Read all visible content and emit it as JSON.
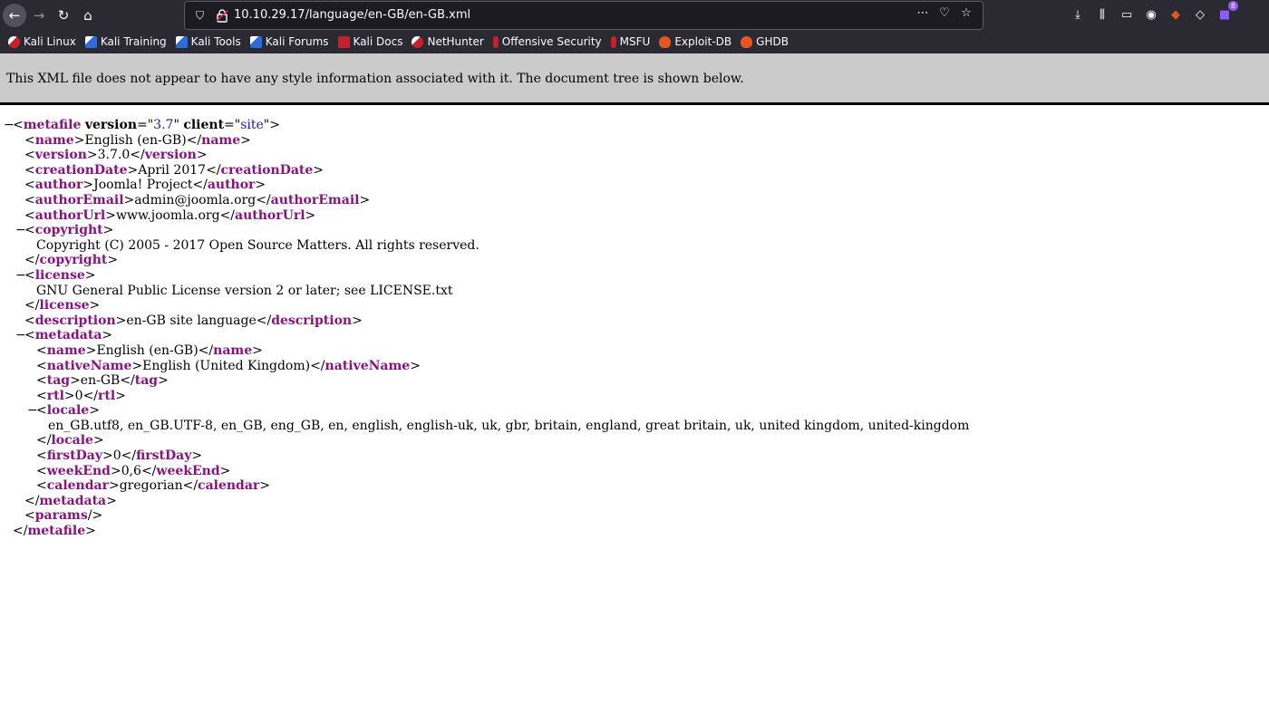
{
  "browser": {
    "url": "10.10.29.17/language/en-GB/en-GB.xml",
    "extension_count": "8",
    "bookmarks": [
      {
        "label": "Kali Linux",
        "icon": "kali-icon"
      },
      {
        "label": "Kali Training",
        "icon": "kali-training-icon"
      },
      {
        "label": "Kali Tools",
        "icon": "kali-tools-icon"
      },
      {
        "label": "Kali Forums",
        "icon": "kali-forums-icon"
      },
      {
        "label": "Kali Docs",
        "icon": "kali-docs-icon"
      },
      {
        "label": "NetHunter",
        "icon": "nethunter-icon"
      },
      {
        "label": "Offensive Security",
        "icon": "offensive-security-icon"
      },
      {
        "label": "MSFU",
        "icon": "msfu-icon"
      },
      {
        "label": "Exploit-DB",
        "icon": "exploit-db-icon"
      },
      {
        "label": "GHDB",
        "icon": "ghdb-icon"
      }
    ]
  },
  "xml_viewer": {
    "info": "This XML file does not appear to have any style information associated with it. The document tree is shown below.",
    "root": {
      "tag": "metafile",
      "version_attr": "version",
      "version": "3.7",
      "client_attr": "client",
      "client": "site",
      "params": "params"
    },
    "elements": {
      "name": {
        "tag": "name",
        "text": "English (en-GB)"
      },
      "version": {
        "tag": "version",
        "text": "3.7.0"
      },
      "creationDate": {
        "tag": "creationDate",
        "text": "April 2017"
      },
      "author": {
        "tag": "author",
        "text": "Joomla! Project"
      },
      "authorEmail": {
        "tag": "authorEmail",
        "text": "admin@joomla.org"
      },
      "authorUrl": {
        "tag": "authorUrl",
        "text": "www.joomla.org"
      },
      "copyright": {
        "tag": "copyright",
        "text": "Copyright (C) 2005 - 2017 Open Source Matters. All rights reserved."
      },
      "license": {
        "tag": "license",
        "text": "GNU General Public License version 2 or later; see LICENSE.txt"
      },
      "description": {
        "tag": "description",
        "text": "en-GB site language"
      }
    },
    "metadata": {
      "tag": "metadata",
      "name": {
        "tag": "name",
        "text": "English (en-GB)"
      },
      "nativeName": {
        "tag": "nativeName",
        "text": "English (United Kingdom)"
      },
      "tag_el": {
        "tag": "tag",
        "text": "en-GB"
      },
      "rtl": {
        "tag": "rtl",
        "text": "0"
      },
      "locale": {
        "tag": "locale",
        "text": "en_GB.utf8, en_GB.UTF-8, en_GB, eng_GB, en, english, english-uk, uk, gbr, britain, england, great britain, uk, united kingdom, united-kingdom"
      },
      "firstDay": {
        "tag": "firstDay",
        "text": "0"
      },
      "weekEnd": {
        "tag": "weekEnd",
        "text": "0,6"
      },
      "calendar": {
        "tag": "calendar",
        "text": "gregorian"
      }
    }
  }
}
